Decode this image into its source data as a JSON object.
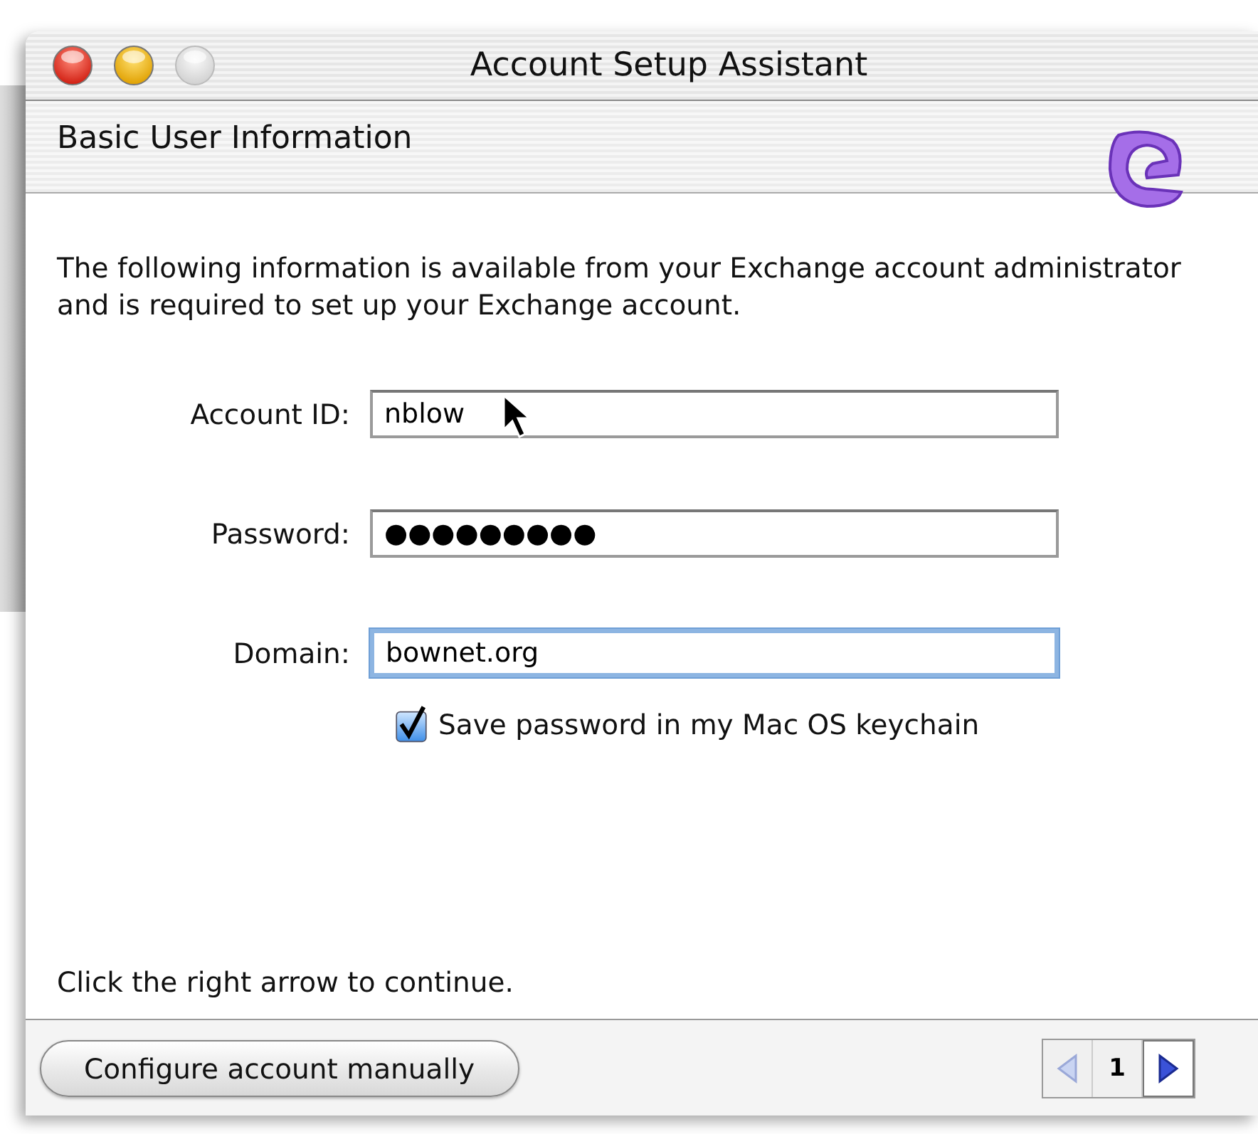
{
  "window": {
    "title": "Account Setup Assistant",
    "controls": [
      {
        "kind": "close",
        "disabled": false
      },
      {
        "kind": "minimize",
        "disabled": false
      },
      {
        "kind": "zoom",
        "disabled": true
      }
    ]
  },
  "header": {
    "title": "Basic User Information"
  },
  "intro": "The following information is available from your Exchange account administrator and is required to set up your Exchange account.",
  "fields": [
    {
      "label": "Account ID:",
      "value": "nblow",
      "focused": false
    },
    {
      "label": "Password:",
      "value": "●●●●●●●●●",
      "focused": false
    },
    {
      "label": "Domain:",
      "value": "bownet.org",
      "focused": true
    }
  ],
  "save_password": {
    "label": "Save password in my Mac OS keychain",
    "checked": true
  },
  "hint": "Click the right arrow to continue.",
  "footer": {
    "button": "Configure account manually",
    "pager": {
      "page": "1",
      "prev_disabled": true,
      "next_disabled": false
    }
  }
}
